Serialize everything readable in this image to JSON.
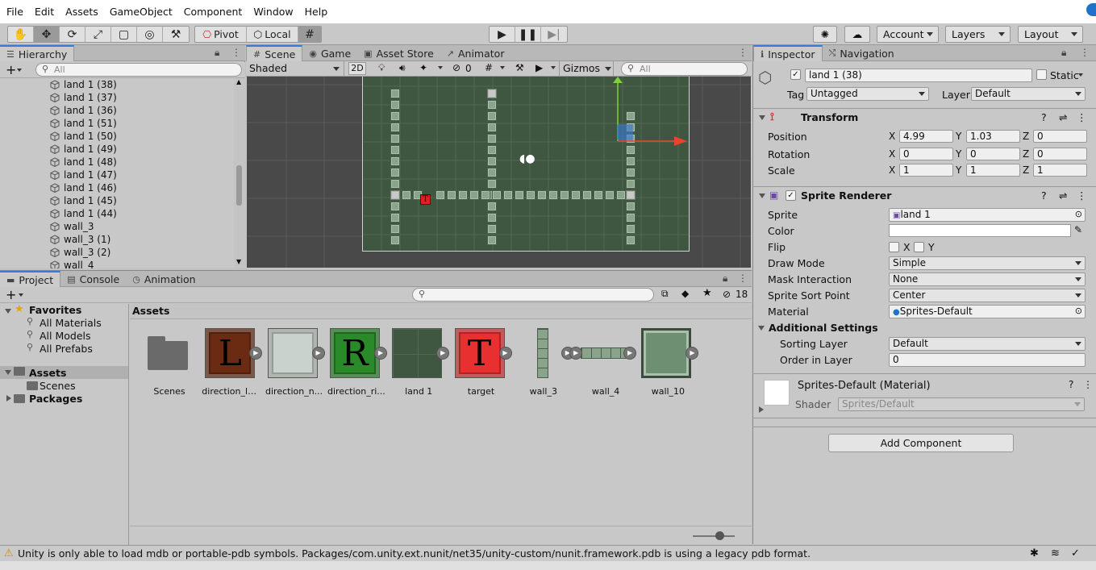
{
  "menu": [
    "File",
    "Edit",
    "Assets",
    "GameObject",
    "Component",
    "Window",
    "Help"
  ],
  "toolbar": {
    "pivot": "Pivot",
    "local": "Local",
    "account": "Account",
    "layers": "Layers",
    "layout": "Layout"
  },
  "hierarchy": {
    "tab": "Hierarchy",
    "search_placeholder": "All",
    "items": [
      "land 1 (38)",
      "land 1 (37)",
      "land 1 (36)",
      "land 1 (51)",
      "land 1 (50)",
      "land 1 (49)",
      "land 1 (48)",
      "land 1 (47)",
      "land 1 (46)",
      "land 1 (45)",
      "land 1 (44)",
      "wall_3",
      "wall_3 (1)",
      "wall_3 (2)",
      "wall_4"
    ]
  },
  "scene": {
    "tabs": [
      "Scene",
      "Game",
      "Asset Store",
      "Animator"
    ],
    "shading": "Shaded",
    "mode_2d": "2D",
    "hidden_count": "0",
    "gizmos": "Gizmos",
    "search_placeholder": "All",
    "highlight_letter": "T"
  },
  "project": {
    "tabs": [
      "Project",
      "Console",
      "Animation"
    ],
    "hidden_count": "18",
    "tree": {
      "favorites": "Favorites",
      "fav_items": [
        "All Materials",
        "All Models",
        "All Prefabs"
      ],
      "assets": "Assets",
      "assets_children": [
        "Scenes"
      ],
      "packages": "Packages"
    },
    "breadcrumb": "Assets",
    "assets": [
      {
        "name": "Scenes",
        "kind": "folder"
      },
      {
        "name": "direction_le...",
        "kind": "tile",
        "letter": "L",
        "bg": "#6b2a12",
        "fg": "#000000"
      },
      {
        "name": "direction_n...",
        "kind": "tile",
        "letter": "",
        "bg": "#c9d2cd",
        "fg": "#000000"
      },
      {
        "name": "direction_ri...",
        "kind": "tile",
        "letter": "R",
        "bg": "#2a8a2a",
        "fg": "#000000"
      },
      {
        "name": "land 1",
        "kind": "land"
      },
      {
        "name": "target",
        "kind": "tile",
        "letter": "T",
        "bg": "#e83030",
        "fg": "#000000"
      },
      {
        "name": "wall_3",
        "kind": "wall3"
      },
      {
        "name": "wall_4",
        "kind": "wall4"
      },
      {
        "name": "wall_10",
        "kind": "wall10"
      }
    ]
  },
  "inspector": {
    "tabs": [
      "Inspector",
      "Navigation"
    ],
    "object_name": "land 1 (38)",
    "static_label": "Static",
    "tag_label": "Tag",
    "tag_value": "Untagged",
    "layer_label": "Layer",
    "layer_value": "Default",
    "transform": {
      "title": "Transform",
      "position_label": "Position",
      "rotation_label": "Rotation",
      "scale_label": "Scale",
      "position": [
        "4.99",
        "1.03",
        "0"
      ],
      "rotation": [
        "0",
        "0",
        "0"
      ],
      "scale": [
        "1",
        "1",
        "1"
      ]
    },
    "sprite_renderer": {
      "title": "Sprite Renderer",
      "sprite_label": "Sprite",
      "sprite_value": "land 1",
      "color_label": "Color",
      "flip_label": "Flip",
      "flip_x": "X",
      "flip_y": "Y",
      "draw_mode_label": "Draw Mode",
      "draw_mode": "Simple",
      "mask_label": "Mask Interaction",
      "mask": "None",
      "sort_point_label": "Sprite Sort Point",
      "sort_point": "Center",
      "material_label": "Material",
      "material": "Sprites-Default",
      "additional": "Additional Settings",
      "sorting_layer_label": "Sorting Layer",
      "sorting_layer": "Default",
      "order_label": "Order in Layer",
      "order": "0"
    },
    "material_block": {
      "title": "Sprites-Default (Material)",
      "shader_label": "Shader",
      "shader": "Sprites/Default"
    },
    "add_component": "Add Component"
  },
  "status": {
    "message": "Unity is only able to load mdb or portable-pdb symbols. Packages/com.unity.ext.nunit/net35/unity-custom/nunit.framework.pdb is using a legacy pdb format."
  },
  "colors": {
    "accent": "#3a7bd5",
    "scene_bg": "#494949",
    "grid_green": "#3f5640",
    "gizmo_x": "#e8452c",
    "gizmo_y": "#7ed13a"
  }
}
